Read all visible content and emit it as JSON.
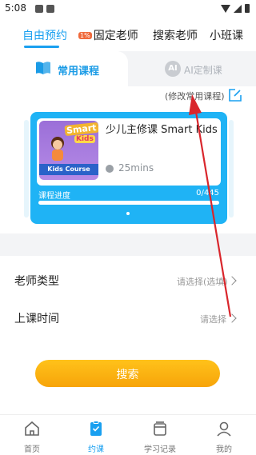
{
  "status_bar": {
    "time": "5:08"
  },
  "top_tabs": [
    {
      "label": "自由预约",
      "active": true
    },
    {
      "label": "固定老师",
      "badge": "1%"
    },
    {
      "label": "搜索老师"
    },
    {
      "label": "小班课"
    }
  ],
  "segment": {
    "left_label": "常用课程",
    "right_icon_text": "AI",
    "right_label": "AI定制课"
  },
  "modify_link": "(修改常用课程)",
  "course": {
    "thumb_smart": "Smart",
    "thumb_kids": "Kids",
    "thumb_banner": "Kids Course",
    "title": "少儿主修课 Smart Kids",
    "duration": "25mins",
    "progress_label": "课程进度",
    "progress_count": "0/445",
    "progress_fraction": 0
  },
  "form": {
    "teacher_type_label": "老师类型",
    "teacher_type_value": "请选择(选填)",
    "class_time_label": "上课时间",
    "class_time_value": "请选择"
  },
  "search_button": "搜索",
  "bottom_nav": [
    {
      "label": "首页"
    },
    {
      "label": "约课",
      "active": true
    },
    {
      "label": "学习记录"
    },
    {
      "label": "我的"
    }
  ],
  "colors": {
    "accent": "#1aa0f0",
    "button": "#f7a40a",
    "annotation": "#d9262c"
  }
}
